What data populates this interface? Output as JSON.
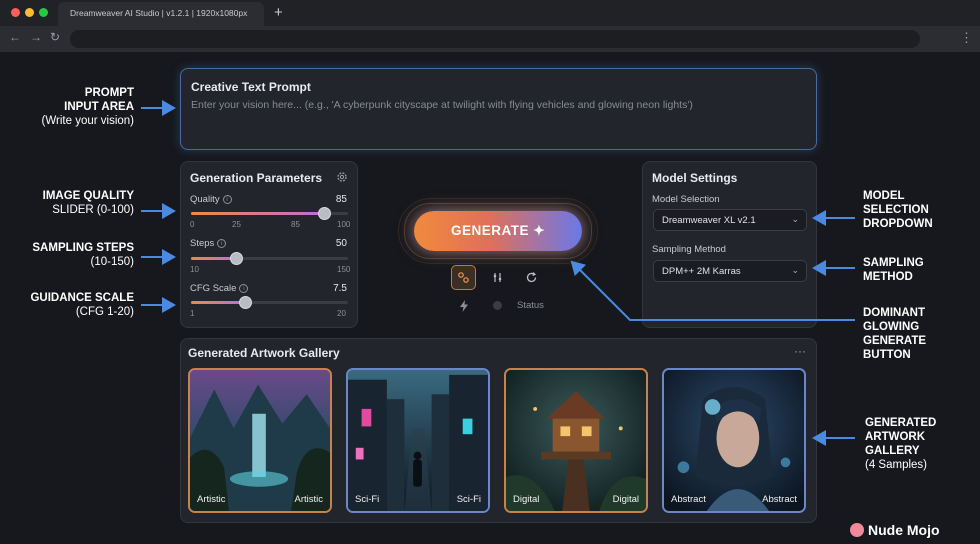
{
  "browser": {
    "tab_title": "Dreamweaver AI Studio | v1.2.1 | 1920x1080px",
    "new_tab": "+",
    "back": "←",
    "forward": "→",
    "reload": "↻",
    "menu": "⋮",
    "traffic_colors": [
      "#ff5f57",
      "#febc2e",
      "#28c840"
    ]
  },
  "prompt": {
    "title": "Creative Text Prompt",
    "placeholder": "Enter your vision here... (e.g., 'A cyberpunk cityscape at twilight with flying vehicles and glowing neon lights')"
  },
  "generation_parameters": {
    "title": "Generation Parameters",
    "icon": "gear-icon",
    "quality": {
      "label": "Quality",
      "value": "85",
      "ticks": [
        "0",
        "25",
        "85",
        "100"
      ],
      "level": 85,
      "min": 0,
      "max": 100
    },
    "steps": {
      "label": "Steps",
      "value": "50",
      "ticks": [
        "10",
        "150"
      ],
      "level": 50,
      "min": 10,
      "max": 150
    },
    "cfg": {
      "label": "CFG Scale",
      "value": "7.5",
      "ticks": [
        "1",
        "20"
      ],
      "level": 7.5,
      "min": 1,
      "max": 20
    }
  },
  "model_settings": {
    "title": "Model Settings",
    "model_label": "Model Selection",
    "model_value": "Dreamweaver XL v2.1",
    "sampling_label": "Sampling Method",
    "sampling_value": "DPM++ 2M Karras"
  },
  "generate": {
    "label": "GENERATE ✦",
    "status": "Status",
    "accent_from": "#f08a3c",
    "accent_to": "#6a78e8"
  },
  "gallery": {
    "title": "Generated Artwork Gallery",
    "more": "···",
    "cards": [
      {
        "left": "Artistic",
        "right": "Artistic"
      },
      {
        "left": "Sci-Fi",
        "right": "Sci-Fi"
      },
      {
        "left": "Digital",
        "right": "Digital"
      },
      {
        "left": "Abstract",
        "right": "Abstract"
      }
    ]
  },
  "annotations": {
    "prompt": {
      "l1": "PROMPT",
      "l2": "INPUT AREA",
      "l3": "(Write your vision)"
    },
    "quality": {
      "l1": "IMAGE QUALITY",
      "l2": "SLIDER (0-100)"
    },
    "steps": {
      "l1": "SAMPLING STEPS",
      "l2": "(10-150)"
    },
    "guidance": {
      "l1": "GUIDANCE SCALE",
      "l2": "(CFG 1-20)"
    },
    "model": {
      "l1": "MODEL",
      "l2": "SELECTION",
      "l3": "DROPDOWN"
    },
    "sampling": {
      "l1": "SAMPLING",
      "l2": "METHOD"
    },
    "generate": {
      "l1": "DOMINANT",
      "l2": "GLOWING",
      "l3": "GENERATE",
      "l4": "BUTTON"
    },
    "gallery": {
      "l1": "GENERATED",
      "l2": "ARTWORK",
      "l3": "GALLERY",
      "l4": "(4 Samples)"
    }
  },
  "watermark": "Nude Mojo"
}
